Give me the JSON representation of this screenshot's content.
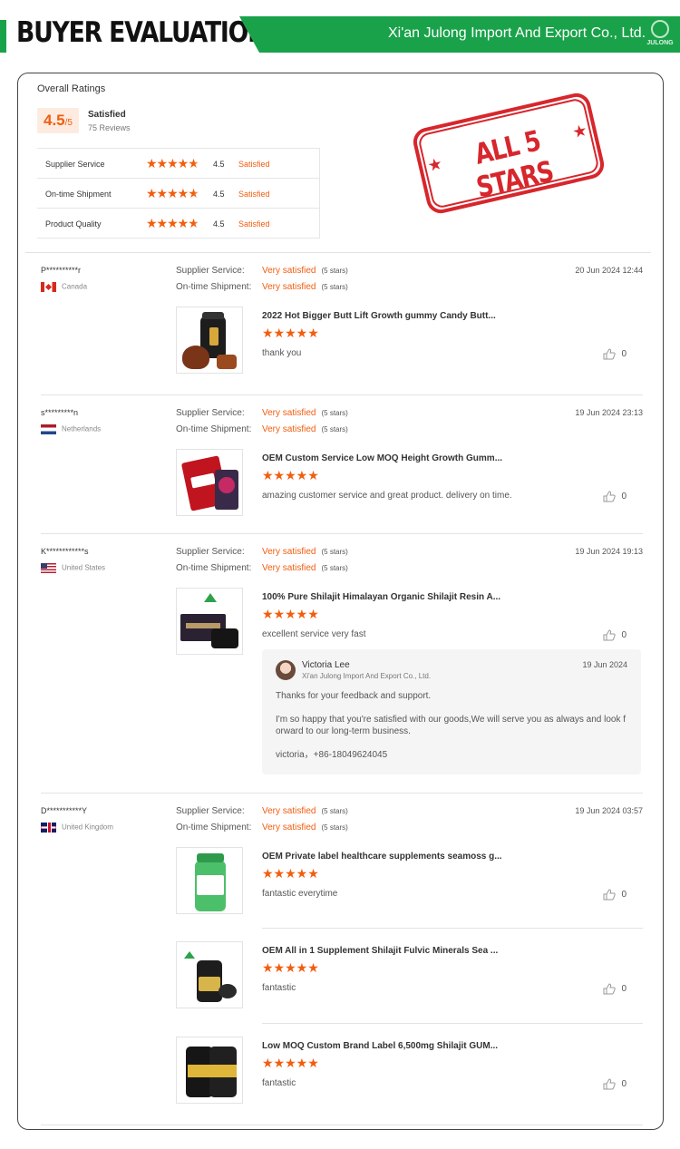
{
  "header": {
    "title": "BUYER EVALUATION",
    "company": "Xi'an Julong Import And Export Co., Ltd.",
    "logo_text": "JULONG",
    "accent_color": "#1aa24a"
  },
  "overall": {
    "title": "Overall Ratings",
    "score": "4.5",
    "score_max": "/5",
    "label": "Satisfied",
    "reviews": "75 Reviews",
    "rows": [
      {
        "label": "Supplier Service",
        "rating": 4.5,
        "value": "4.5",
        "status": "Satisfied"
      },
      {
        "label": "On-time Shipment",
        "rating": 4.5,
        "value": "4.5",
        "status": "Satisfied"
      },
      {
        "label": "Product Quality",
        "rating": 4.5,
        "value": "4.5",
        "status": "Satisfied"
      }
    ]
  },
  "stamp": {
    "text": "ALL 5 STARS",
    "color": "#d7262c"
  },
  "rating_color": "#f25d0e",
  "labels": {
    "supplier_service": "Supplier Service:",
    "ontime_shipment": "On-time Shipment:",
    "very_satisfied": "Very satisfied",
    "five_stars": "(5 stars)"
  },
  "reviews": [
    {
      "user": "P**********r",
      "country": "Canada",
      "flag": "ca",
      "date": "20 Jun 2024 12:44",
      "products": [
        {
          "title": "2022 Hot Bigger Butt Lift Growth gummy Candy Butt...",
          "rating": 5,
          "comment": "thank you",
          "likes": "0",
          "thumb": "butt"
        }
      ]
    },
    {
      "user": "s*********n",
      "country": "Netherlands",
      "flag": "nl",
      "date": "19 Jun 2024 23:13",
      "products": [
        {
          "title": "OEM Custom Service Low MOQ Height Growth Gumm...",
          "rating": 5,
          "comment": "amazing customer service and great product. delivery on time.",
          "likes": "0",
          "thumb": "height"
        }
      ]
    },
    {
      "user": "K************s",
      "country": "United States",
      "flag": "us",
      "date": "19 Jun 2024 19:13",
      "products": [
        {
          "title": "100% Pure Shilajit Himalayan Organic Shilajit Resin A...",
          "rating": 5,
          "comment": "excellent service very fast",
          "likes": "0",
          "thumb": "shilajit-box"
        }
      ],
      "reply": {
        "name": "Victoria Lee",
        "company": "Xi'an Julong Import And Export Co., Ltd.",
        "date": "19 Jun 2024",
        "para1": "Thanks for your feedback and support.",
        "para2": "I'm so happy that you're satisfied with our goods,We will serve you as always and look f orward to our long-term business.",
        "para3": "victoria，+86-18049624045"
      }
    },
    {
      "user": "D***********Y",
      "country": "United Kingdom",
      "flag": "uk",
      "date": "19 Jun 2024 03:57",
      "products": [
        {
          "title": "OEM Private label healthcare supplements seamoss g...",
          "rating": 5,
          "comment": "fantastic everytime",
          "likes": "0",
          "thumb": "seamoss"
        },
        {
          "title": "OEM All in 1 Supplement Shilajit Fulvic Minerals Sea ...",
          "rating": 5,
          "comment": "fantastic",
          "likes": "0",
          "thumb": "allinone"
        },
        {
          "title": "Low MOQ Custom Brand Label 6,500mg Shilajit GUM...",
          "rating": 5,
          "comment": "fantastic",
          "likes": "0",
          "thumb": "shilajit-gum"
        }
      ]
    }
  ]
}
